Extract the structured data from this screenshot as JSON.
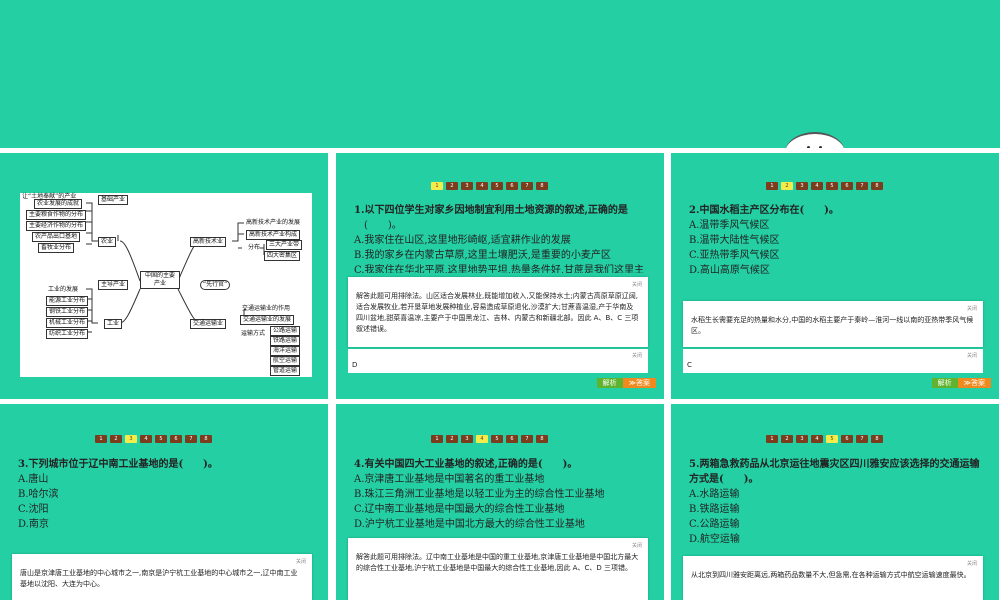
{
  "nav_pages": [
    "1",
    "2",
    "3",
    "4",
    "5",
    "6",
    "7",
    "8"
  ],
  "buttons": {
    "analysis": "解析",
    "answer": "≫答案"
  },
  "close_label": "关闭",
  "mindmap": {
    "center": "中国的主要产业",
    "left_top_heading": "让“土地奉献”的产业",
    "basic": "基础产业",
    "agriculture": "农业",
    "agri_items": [
      "农业发展的成就",
      "主要粮食作物的分布",
      "主要经济作物的分布",
      "农产品出口基地",
      "畜牧业分布"
    ],
    "leading": "主导产业",
    "industry": "工业",
    "ind_items": [
      "工业的发展",
      "能源工业分布",
      "钢铁工业分布",
      "机械工业分布",
      "纺织工业分布"
    ],
    "hightech": "高新技术业",
    "ht_items": [
      "高新技术产业的发展",
      "高新技术产业构成",
      "三大产业带",
      "四大密集区"
    ],
    "ht_dist": "分布",
    "pioneer": "“先行官”",
    "transport": "交通运输业",
    "tr_items": [
      "交通运输业的作用",
      "交通运输业的发展"
    ],
    "tr_modes": "运输方式",
    "mode_items": [
      "公路运输",
      "铁路运输",
      "海洋运输",
      "航空运输",
      "管道运输"
    ]
  },
  "q1": {
    "stem": "1.以下四位学生对家乡因地制宜利用土地资源的叙述,正确的是",
    "paren": "(　　)。",
    "options": [
      "A.我家住在山区,这里地形崎岖,适宜耕作业的发展",
      "B.我的家乡在内蒙古草原,这里土壤肥沃,是重要的小麦产区",
      "C.我家住在华北平原,这里地势平坦,热量条件好,甘蔗是我们这里主"
    ],
    "explanation": "解答此题可用排除法。山区适合发展林业,既能增加收入,又能保持水土;内蒙古高原草原辽阔,适合发展牧业,若开垦草地发展种植业,容易造成草原退化,沙漠扩大;甘蔗喜温湿,产于华南及四川盆地,甜菜喜温凉,主要产于中国黑龙江、吉林、内蒙古和新疆北部。因此 A、B、C 三项叙述错误。",
    "answer": "D"
  },
  "q2": {
    "stem": "2.中国水稻主产区分布在(　　)。",
    "options": [
      "A.温带季风气候区",
      "B.温带大陆性气候区",
      "C.亚热带季风气候区",
      "D.高山高原气候区"
    ],
    "explanation": "水稻生长需要充足的热量和水分,中国的水稻主要产于秦岭—淮河一线以南的亚热带季风气候区。",
    "answer": "C"
  },
  "q3": {
    "stem": "3.下列城市位于辽中南工业基地的是(　　)。",
    "options": [
      "A.唐山",
      "B.哈尔滨",
      "C.沈阳",
      "D.南京"
    ],
    "explanation": "唐山是京津唐工业基地的中心城市之一,南京是沪宁杭工业基地的中心城市之一,辽中南工业基地以沈阳、大连为中心。"
  },
  "q4": {
    "stem": "4.有关中国四大工业基地的叙述,正确的是(　　)。",
    "options": [
      "A.京津唐工业基地是中国著名的重工业基地",
      "B.珠江三角洲工业基地是以轻工业为主的综合性工业基地",
      "C.辽中南工业基地是中国最大的综合性工业基地",
      "D.沪宁杭工业基地是中国北方最大的综合性工业基地"
    ],
    "explanation": "解答此题可用排除法。辽中南工业基地是中国的重工业基地,京津唐工业基地是中国北方最大的综合性工业基地,沪宁杭工业基地是中国最大的综合性工业基地,因此 A、C、D 三项错。"
  },
  "q5": {
    "stem": "5.两箱急救药品从北京运往地震灾区四川雅安应该选择的交通运输方式是(　　)。",
    "options": [
      "A.水路运输",
      "B.铁路运输",
      "C.公路运输",
      "D.航空运输"
    ],
    "explanation": "从北京到四川雅安距离远,两箱药品数量不大,但急需,在各种运输方式中航空运输速度最快。"
  },
  "colors": {
    "slide_bg": "#23cfa3",
    "nav": "#7a3e1e",
    "nav_active": "#f3ec4a",
    "btn_analysis": "#5fb32f",
    "btn_answer": "#f08a1e"
  }
}
